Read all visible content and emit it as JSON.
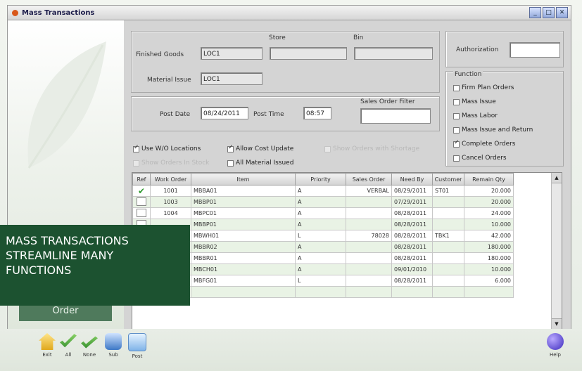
{
  "window": {
    "title": "Mass Transactions",
    "min": "_",
    "max": "□",
    "close": "✕"
  },
  "overlay": {
    "line1": "MASS TRANSACTIONS",
    "line2": "STREAMLINE MANY",
    "line3": "FUNCTIONS"
  },
  "sidebar": {
    "tab_label": "Order"
  },
  "location": {
    "store_label": "Store",
    "bin_label": "Bin",
    "finished_goods_label": "Finished Goods",
    "finished_goods_value": "LOC1",
    "material_issue_label": "Material Issue",
    "material_issue_value": "LOC1"
  },
  "post": {
    "date_label": "Post Date",
    "date_value": "08/24/2011",
    "time_label": "Post Time",
    "time_value": "08:57",
    "sales_filter_label": "Sales Order Filter",
    "sales_filter_value": ""
  },
  "authorization": {
    "label": "Authorization",
    "value": ""
  },
  "function_group": {
    "title": "Function",
    "options": [
      {
        "label": "Firm Plan Orders",
        "checked": false
      },
      {
        "label": "Mass Issue",
        "checked": false
      },
      {
        "label": "Mass Labor",
        "checked": false
      },
      {
        "label": "Mass Issue and Return",
        "checked": false
      },
      {
        "label": "Complete Orders",
        "checked": true
      },
      {
        "label": "Cancel Orders",
        "checked": false
      }
    ]
  },
  "options": {
    "use_wo_locations": {
      "label": "Use W/O Locations",
      "checked": true
    },
    "allow_cost_update": {
      "label": "Allow Cost Update",
      "checked": true
    },
    "opt_disabled_1": {
      "label": "Show Orders with Shortage",
      "checked": false
    },
    "opt_disabled_2": {
      "label": "Show Orders In Stock",
      "checked": false
    },
    "all_material_issued": {
      "label": "All Material Issued",
      "checked": false
    }
  },
  "grid": {
    "headers": [
      "Ref",
      "Work Order",
      "Item",
      "Priority",
      "Sales Order",
      "Need By",
      "Customer",
      "Remain Qty"
    ],
    "rows": [
      {
        "check": "✔",
        "wo": "1001",
        "item": "MBBA01",
        "priority": "A",
        "so": "VERBAL",
        "need": "08/29/2011",
        "cust": "ST01",
        "qty": "20.000"
      },
      {
        "check": "",
        "wo": "1003",
        "item": "MBBP01",
        "priority": "A",
        "so": "",
        "need": "07/29/2011",
        "cust": "",
        "qty": "20.000"
      },
      {
        "check": "",
        "wo": "1004",
        "item": "MBPC01",
        "priority": "A",
        "so": "",
        "need": "08/28/2011",
        "cust": "",
        "qty": "24.000"
      },
      {
        "check": "",
        "wo": "",
        "item": "MBBP01",
        "priority": "A",
        "so": "",
        "need": "08/28/2011",
        "cust": "",
        "qty": "10.000"
      },
      {
        "check": "",
        "wo": "",
        "item": "MBWH01",
        "priority": "L",
        "so": "78028",
        "need": "08/28/2011",
        "cust": "TBK1",
        "qty": "42.000"
      },
      {
        "check": "",
        "wo": "",
        "item": "MBBR02",
        "priority": "A",
        "so": "",
        "need": "08/28/2011",
        "cust": "",
        "qty": "180.000"
      },
      {
        "check": "",
        "wo": "",
        "item": "MBBR01",
        "priority": "A",
        "so": "",
        "need": "08/28/2011",
        "cust": "",
        "qty": "180.000"
      },
      {
        "check": "",
        "wo": "",
        "item": "MBCH01",
        "priority": "A",
        "so": "",
        "need": "09/01/2010",
        "cust": "",
        "qty": "10.000"
      },
      {
        "check": "",
        "wo": "",
        "item": "MBFG01",
        "priority": "L",
        "so": "",
        "need": "08/28/2011",
        "cust": "",
        "qty": "6.000"
      },
      {
        "check": "",
        "wo": "",
        "item": "",
        "priority": "",
        "so": "",
        "need": "",
        "cust": "",
        "qty": ""
      }
    ]
  },
  "toolbar": {
    "exit": "Exit",
    "all": "All",
    "none": "None",
    "sub": "Sub",
    "post": "Post",
    "help": "Help"
  }
}
